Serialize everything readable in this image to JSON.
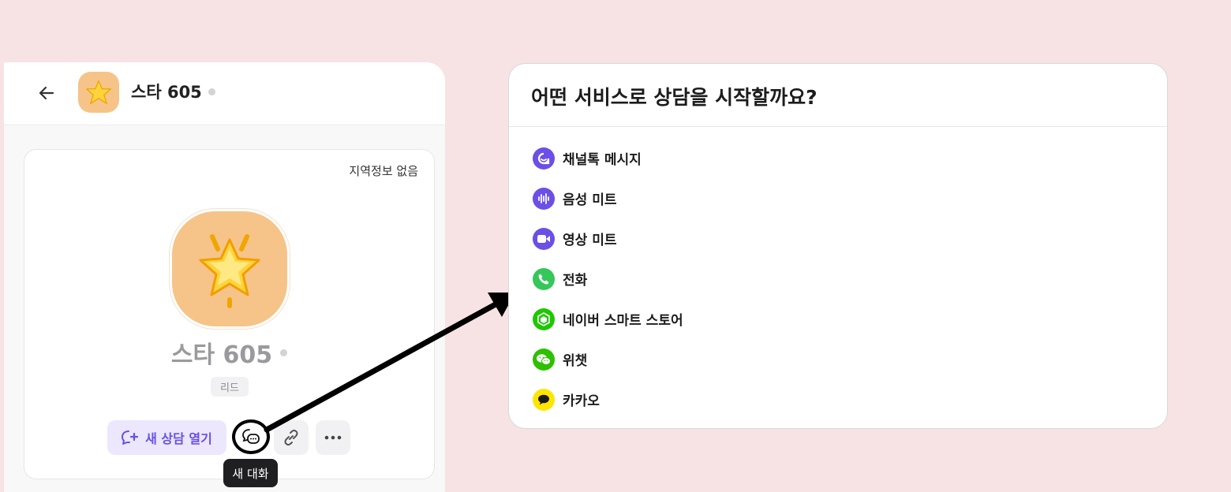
{
  "profile": {
    "name": "스타 605",
    "region": "지역정보 없음",
    "tag": "리드",
    "actions": {
      "open_chat_label": "새 상담 열기",
      "tooltip": "새 대화"
    }
  },
  "dialog": {
    "title": "어떤 서비스로 상담을 시작할까요?",
    "options": [
      {
        "label": "채널톡 메시지",
        "icon": "channeltalk-icon",
        "color": "#6b4fe6"
      },
      {
        "label": "음성 미트",
        "icon": "voice-meet-icon",
        "color": "#6b4fe6"
      },
      {
        "label": "영상 미트",
        "icon": "video-meet-icon",
        "color": "#6b4fe6"
      },
      {
        "label": "전화",
        "icon": "phone-icon",
        "color": "#34c759"
      },
      {
        "label": "네이버 스마트 스토어",
        "icon": "naver-smartstore-icon",
        "color": "#1ec800"
      },
      {
        "label": "위챗",
        "icon": "wechat-icon",
        "color": "#2dc100"
      },
      {
        "label": "카카오",
        "icon": "kakao-icon",
        "color": "#fee500"
      }
    ]
  },
  "colors": {
    "background": "#f7e3e4",
    "accent": "#6b4fe6",
    "avatar": "#f6c488"
  }
}
